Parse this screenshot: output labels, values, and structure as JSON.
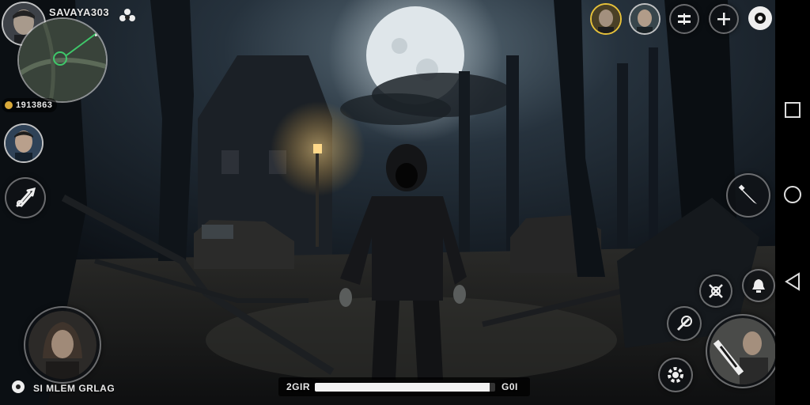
{
  "player": {
    "name": "SAVAYA303"
  },
  "currency": {
    "value": "1913863"
  },
  "bottom_left": {
    "label": "SI MLEM GRLAG"
  },
  "progress": {
    "left_label": "2GIR",
    "right_label": "G0I",
    "fill_fraction": 0.97
  },
  "colors": {
    "moon": "#dfe6ea",
    "lamp": "#ffd98a",
    "minimap_marker": "#3fc86a"
  },
  "icons": {
    "top_right": [
      "avatar-player-2",
      "avatar-player-3",
      "menu-grid-icon",
      "plus-icon",
      "eye-icon"
    ],
    "left": [
      "avatar-ally",
      "tools-icon",
      "voice-avatar"
    ],
    "right_actions": [
      "knife-icon",
      "crosshair-icon",
      "bell-icon",
      "sword-icon",
      "gear-icon",
      "attack-avatar"
    ],
    "system_nav": [
      "square-nav-icon",
      "circle-nav-icon",
      "back-triangle-icon"
    ]
  }
}
